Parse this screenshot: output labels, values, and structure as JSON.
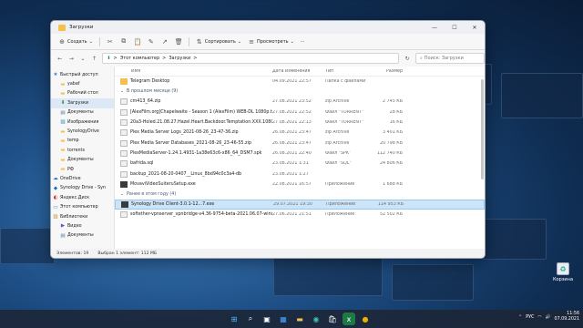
{
  "window": {
    "title": "Загрузки"
  },
  "toolbar": {
    "create": "Создать",
    "sort": "Сортировать",
    "view": "Просмотреть",
    "more": "···"
  },
  "address": {
    "home": "Этот компьютер",
    "sep": ">",
    "folder": "Загрузки",
    "search_placeholder": "Поиск: Загрузки"
  },
  "sidebar": {
    "items": [
      {
        "label": "Быстрый доступ",
        "icon": "star-icon"
      },
      {
        "label": "yabaf",
        "icon": "folder-icon"
      },
      {
        "label": "Рабочий стол",
        "icon": "folder-icon"
      },
      {
        "label": "Загрузки",
        "icon": "download-icon",
        "selected": true
      },
      {
        "label": "Документы",
        "icon": "doc-icon"
      },
      {
        "label": "Изображения",
        "icon": "image-icon"
      },
      {
        "label": "SynologyDrive",
        "icon": "folder-icon"
      },
      {
        "label": "temp",
        "icon": "folder-icon"
      },
      {
        "label": "torrents",
        "icon": "folder-icon"
      },
      {
        "label": "Документы",
        "icon": "folder-icon"
      },
      {
        "label": "РФ",
        "icon": "folder-icon"
      },
      {
        "label": "OneDrive",
        "icon": "cloud-icon"
      },
      {
        "label": "Synology Drive - Syn",
        "icon": "synology-icon"
      },
      {
        "label": "Яндекс.Диск",
        "icon": "yandex-icon"
      },
      {
        "label": "Этот компьютер",
        "icon": "pc-icon"
      },
      {
        "label": "Библиотеки",
        "icon": "library-icon"
      },
      {
        "label": "Видео",
        "icon": "video-icon"
      },
      {
        "label": "Документы",
        "icon": "doc-icon"
      }
    ]
  },
  "columns": {
    "name": "Имя",
    "date": "Дата изменения",
    "type": "Тип",
    "size": "Размер"
  },
  "top_row": {
    "name": "Telegram Desktop",
    "date": "04.09.2021 22:57",
    "type": "Папка с файлами",
    "size": ""
  },
  "group1": "В прошлом месяце (9)",
  "group1_rows": [
    {
      "name": "cm413_64.zip",
      "date": "27.08.2021 23:52",
      "type": "zip Archive",
      "size": "2 745 КБ",
      "icon": "doc"
    },
    {
      "name": "[AlexFilm.org]Chapelwaite - Season 1 (AlexFilm) WEB-DL 1080p.torrent",
      "date": "27.08.2021 22:52",
      "type": "Файл \"TORRENT\"",
      "size": "28 КБ",
      "icon": "doc"
    },
    {
      "name": "20a3-Holed.21.08.27.Hazel.Heart.Backdoor.Temptation.XXX.1080p.MP4…",
      "date": "27.08.2021 22:13",
      "type": "Файл \"TORRENT\"",
      "size": "16 КБ",
      "icon": "doc"
    },
    {
      "name": "Plex Media Server Logs_2021-08-26_23-47-36.zip",
      "date": "26.08.2021 23:47",
      "type": "zip Archive",
      "size": "3 401 КБ",
      "icon": "doc"
    },
    {
      "name": "Plex Media Server Databases_2021-08-26_23-46-55.zip",
      "date": "26.08.2021 23:47",
      "type": "zip Archive",
      "size": "20 798 КБ",
      "icon": "doc"
    },
    {
      "name": "PlexMediaServer-1.24.1.4931-1a38e63c6-x86_64_DSM7.spk",
      "date": "26.08.2021 22:40",
      "type": "Файл \"SPK\"",
      "size": "112 740 КБ",
      "icon": "doc"
    },
    {
      "name": "bafrida.sql",
      "date": "23.08.2021 1:31",
      "type": "Файл \"SQL\"",
      "size": "24 806 КБ",
      "icon": "doc"
    },
    {
      "name": "backup_2021-08-20-0407__Linux_8bd94c0c3a4-db",
      "date": "23.08.2021 1:27",
      "type": "",
      "size": "",
      "icon": "doc"
    },
    {
      "name": "MovaviVideoSuiteruSetup.exe",
      "date": "22.08.2021 16:57",
      "type": "Приложение",
      "size": "1 688 КБ",
      "icon": "exe"
    }
  ],
  "group2": "Ранее в этом году (4)",
  "group2_rows": [
    {
      "name": "Synology Drive Client-3.0.1-12...7.exe",
      "date": "29.07.2021 19:30",
      "type": "Приложение",
      "size": "114 953 КБ",
      "icon": "exe",
      "selected": true
    },
    {
      "name": "softether-vpnserver_vpnbridge-v4.36-9754-beta-2021.06.07-windows-x…",
      "date": "27.06.2021 21:51",
      "type": "Приложение",
      "size": "52 502 КБ",
      "icon": "doc"
    }
  ],
  "status": {
    "count": "Элементов: 19",
    "selected": "Выбран 1 элемент: 112 МБ"
  },
  "desktop": {
    "recycle_label": "Корзина"
  },
  "tray": {
    "lang": "РУС",
    "time": "11:56",
    "date": "07.09.2021"
  }
}
